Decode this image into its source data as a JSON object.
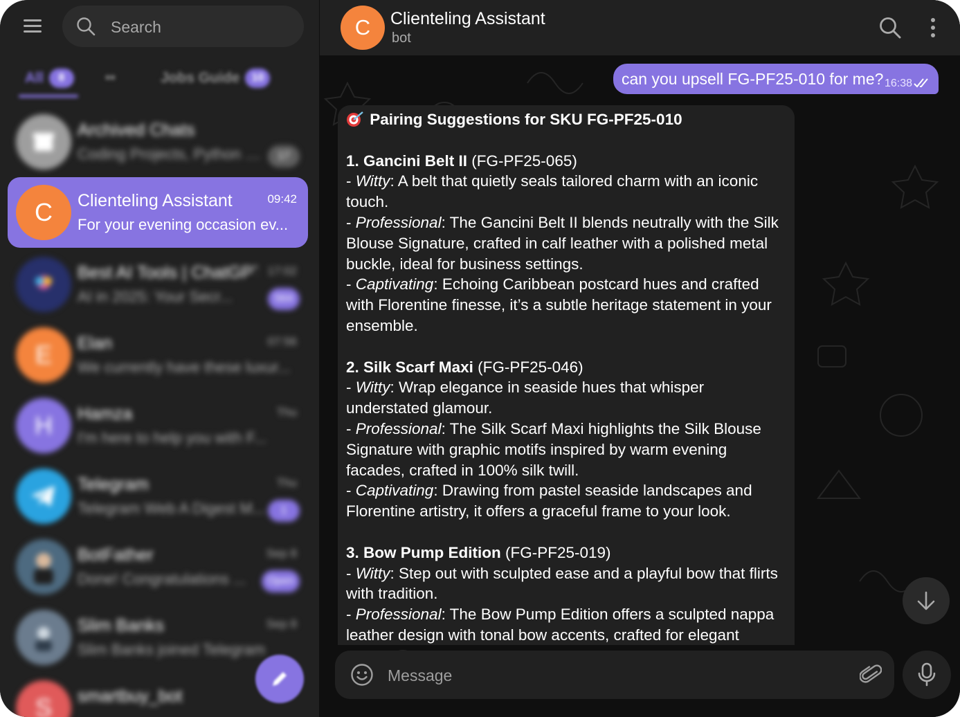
{
  "sidebar": {
    "search_placeholder": "Search",
    "folders": [
      {
        "label": "All",
        "badge": "8"
      },
      {
        "label": "••",
        "badge": ""
      },
      {
        "label": "Jobs Guide",
        "badge": "10"
      }
    ],
    "chats": [
      {
        "name": "Archived Chats",
        "time": "",
        "message": "Coding Projects, Python P...",
        "badge": "17",
        "avatar_letter": "",
        "avatar_color": "#9e9e9e"
      },
      {
        "name": "Clienteling Assistant",
        "time": "09:42",
        "message": "For your evening occasion ev...",
        "badge": "",
        "avatar_letter": "C",
        "avatar_color": "#f4843d"
      },
      {
        "name": "Best AI Tools | ChatGPT ...",
        "time": "17:02",
        "message": "AI in 2025: Your Secr...",
        "badge": "564",
        "avatar_letter": "",
        "avatar_color": "#27306b"
      },
      {
        "name": "Elan",
        "time": "07:56",
        "message": "We currently have these luxur...",
        "badge": "",
        "avatar_letter": "E",
        "avatar_color": "#f4843d"
      },
      {
        "name": "Hamza",
        "time": "Thu",
        "message": "I'm here to help you with F...",
        "badge": "",
        "avatar_letter": "H",
        "avatar_color": "#8774e1"
      },
      {
        "name": "Telegram",
        "time": "Thu",
        "message": "Telegram Web A Digest M...",
        "badge": "1",
        "avatar_letter": "",
        "avatar_color": "#2aa3e0"
      },
      {
        "name": "BotFather",
        "time": "Sep 8",
        "message": "Done! Congratulations ...",
        "badge": "Open",
        "avatar_letter": "",
        "avatar_color": "#4d6a80"
      },
      {
        "name": "Slim Banks",
        "time": "Sep 8",
        "message": "Slim Banks joined Telegram",
        "badge": "",
        "avatar_letter": "",
        "avatar_color": "#6b7c8e"
      },
      {
        "name": "smartbuy_bot",
        "time": "",
        "message": "",
        "badge": "",
        "avatar_letter": "S",
        "avatar_color": "#e05a5a"
      }
    ]
  },
  "header": {
    "avatar_letter": "C",
    "title": "Clienteling Assistant",
    "subtitle": "bot"
  },
  "messages": {
    "outgoing": {
      "text": "can you upsell FG-PF25-010 for me?",
      "time": "16:38"
    },
    "incoming": {
      "heading": "Pairing Suggestions for SKU FG-PF25-010",
      "items": [
        {
          "title": "1. Gancini Belt II",
          "sku": " (FG-PF25-065)",
          "witty_label": "Witty",
          "witty": ": A belt that quietly seals tailored charm with an iconic touch.",
          "professional_label": "Professional",
          "professional": ": The Gancini Belt II blends neutrally with the Silk Blouse Signature, crafted in calf leather with a polished metal buckle, ideal for business settings.",
          "captivating_label": "Captivating",
          "captivating": ": Echoing Caribbean postcard hues and crafted with Florentine finesse, it’s a subtle heritage statement in your ensemble."
        },
        {
          "title": "2. Silk Scarf Maxi",
          "sku": " (FG-PF25-046)",
          "witty_label": "Witty",
          "witty": ": Wrap elegance in seaside hues that whisper understated glamour.",
          "professional_label": "Professional",
          "professional": ": The Silk Scarf Maxi highlights the Silk Blouse Signature with graphic motifs inspired by warm evening facades, crafted in 100% silk twill.",
          "captivating_label": "Captivating",
          "captivating": ": Drawing from pastel seaside landscapes and Florentine artistry, it offers a graceful frame to your look."
        },
        {
          "title": "3. Bow Pump Edition",
          "sku": " (FG-PF25-019)",
          "witty_label": "Witty",
          "witty": ": Step out with sculpted ease and a playful bow that flirts with tradition.",
          "professional_label": "Professional",
          "professional": ": The Bow Pump Edition offers a sculpted nappa leather design with tonal bow accents, crafted for elegant",
          "captivating_label": "",
          "captivating": ""
        }
      ]
    }
  },
  "composer": {
    "placeholder": "Message"
  },
  "colors": {
    "accent": "#8774e1",
    "avatar_orange": "#f4843d",
    "background": "#0f0f0f",
    "panel": "#212121"
  },
  "icons": {
    "menu": "hamburger-icon",
    "search": "search-icon",
    "more": "more-vertical-icon",
    "emoji": "smiley-icon",
    "attach": "paperclip-icon",
    "mic": "microphone-icon",
    "scroll_down": "arrow-down-icon",
    "compose": "pencil-icon",
    "read": "double-check-icon",
    "heading": "dart-target-icon"
  }
}
